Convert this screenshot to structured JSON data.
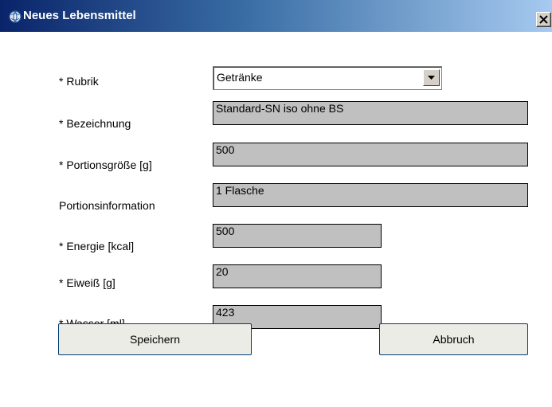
{
  "window": {
    "title": "Neues Lebensmittel",
    "close_label": "✕"
  },
  "form": {
    "rubrik_label": "* Rubrik",
    "rubrik_value": "Getränke",
    "bezeichnung_label": "* Bezeichnung",
    "bezeichnung_value": "Standard-SN iso ohne BS",
    "portionsgroesse_label": "* Portionsgröße [g]",
    "portionsgroesse_value": "500",
    "portionsinformation_label": "Portionsinformation",
    "portionsinformation_value": "1 Flasche",
    "energie_label": "* Energie [kcal]",
    "energie_value": "500",
    "eiweiss_label": "* Eiweiß [g]",
    "eiweiss_value": "20",
    "wasser_label": "* Wasser [ml]",
    "wasser_value": "423"
  },
  "buttons": {
    "save_label": "Speichern",
    "cancel_label": "Abbruch"
  },
  "colors": {
    "titlebar_start": "#0a246a",
    "titlebar_end": "#a6caf0",
    "field_background": "#c0c0c0"
  },
  "icons": {
    "app": "app-globe-icon",
    "close": "close-icon",
    "dropdown": "chevron-down-icon"
  }
}
